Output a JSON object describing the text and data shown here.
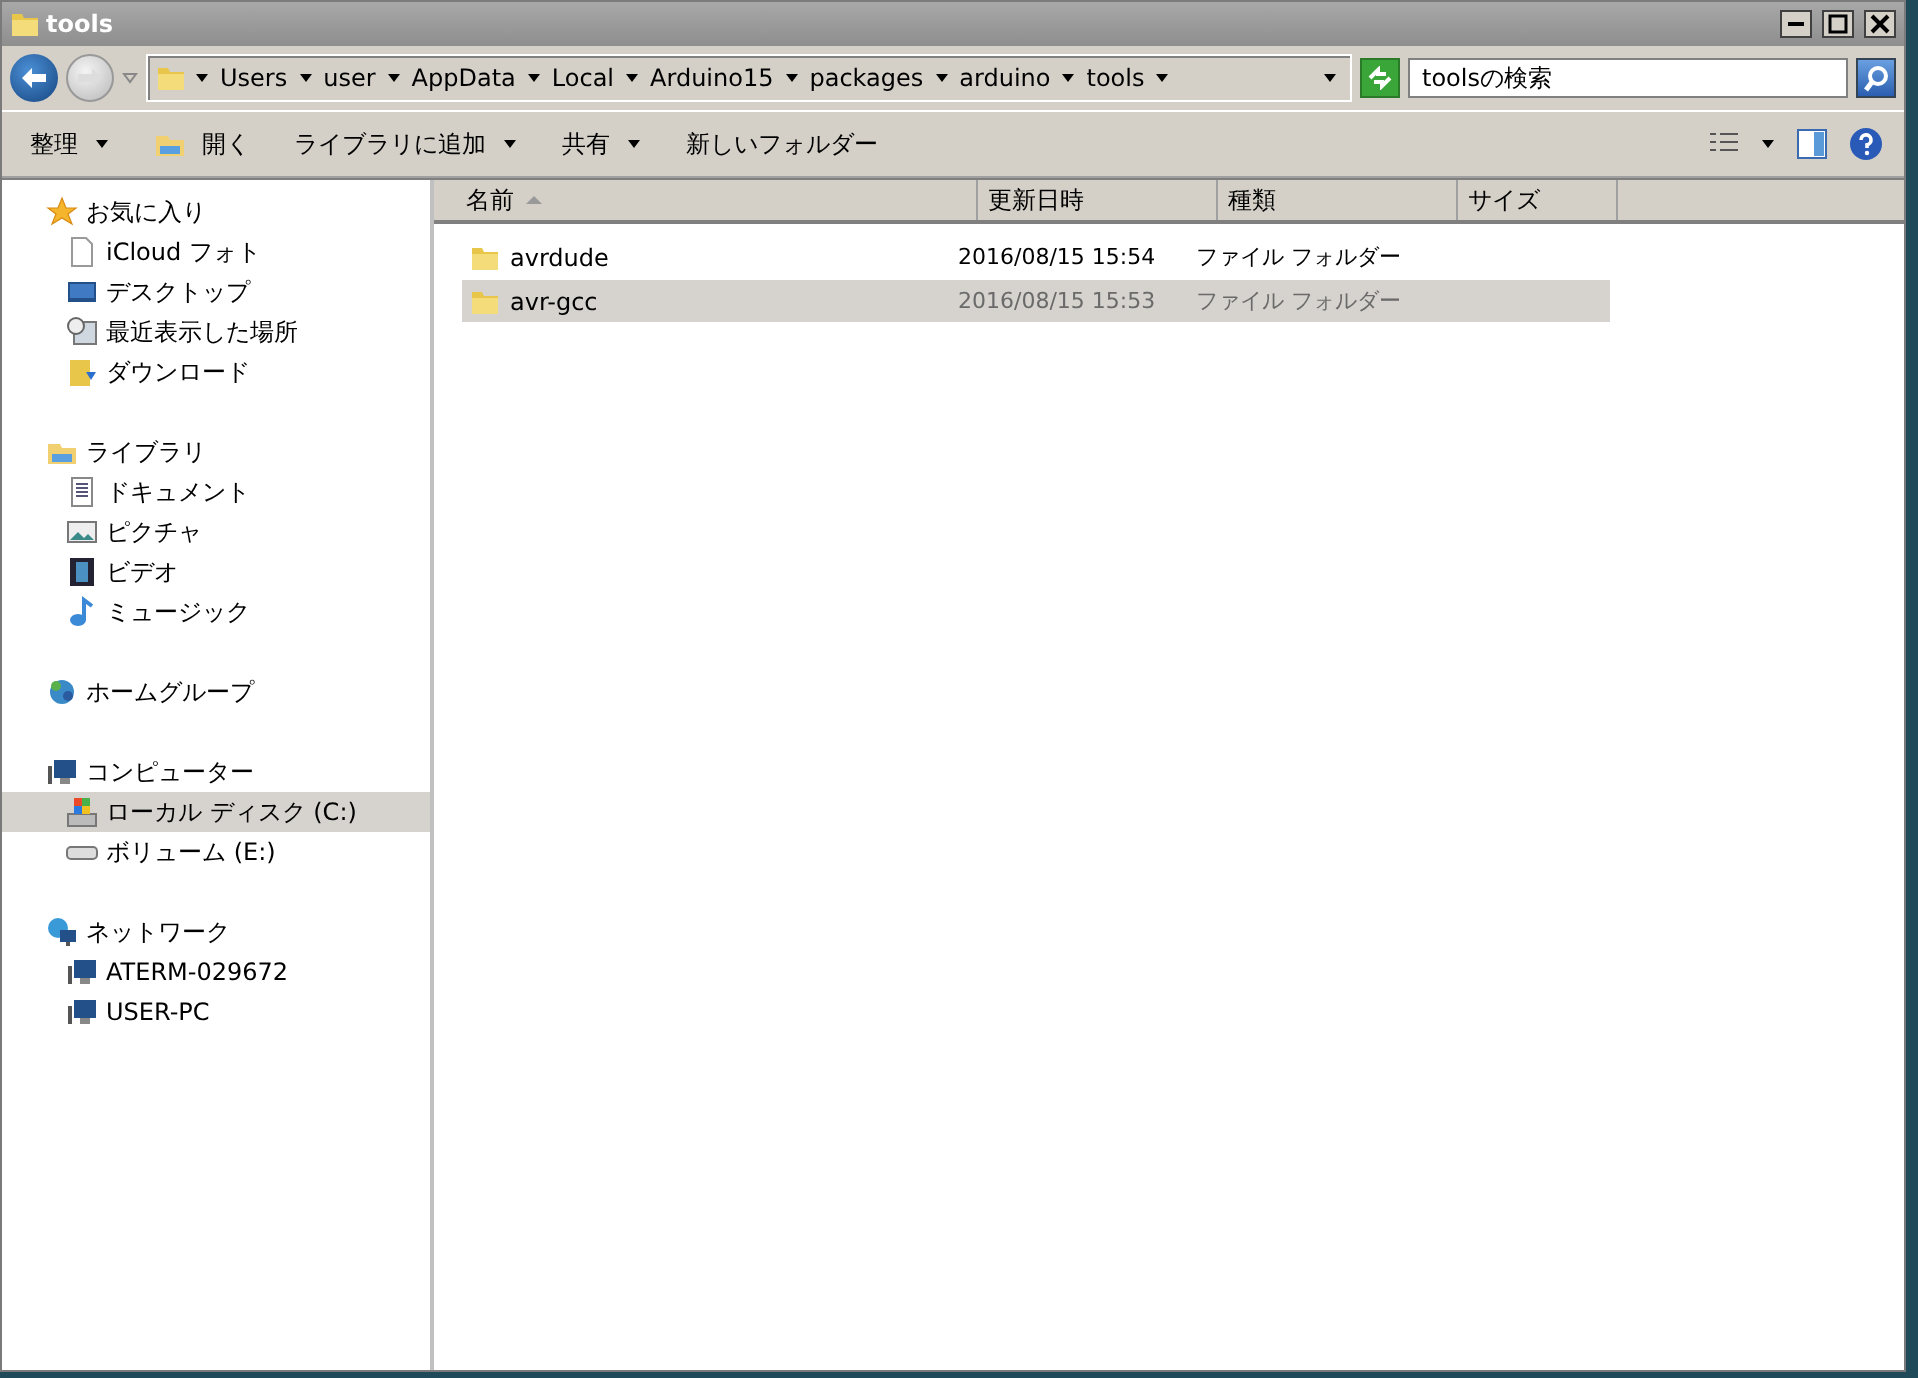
{
  "window": {
    "title": "tools"
  },
  "address_bar": {
    "path": [
      "Users",
      "user",
      "AppData",
      "Local",
      "Arduino15",
      "packages",
      "arduino",
      "tools"
    ]
  },
  "search": {
    "placeholder": "toolsの検索"
  },
  "toolbar": {
    "items": [
      {
        "label": "整理",
        "dropdown": true
      },
      {
        "label": "開く",
        "dropdown": false
      },
      {
        "label": "ライブラリに追加",
        "dropdown": true
      },
      {
        "label": "共有",
        "dropdown": true
      },
      {
        "label": "新しいフォルダー",
        "dropdown": false
      }
    ]
  },
  "sidebar": {
    "groups": [
      {
        "label": "お気に入り",
        "children": [
          {
            "label": "iCloud フォト",
            "selected": false
          },
          {
            "label": "デスクトップ",
            "selected": false
          },
          {
            "label": "最近表示した場所",
            "selected": false
          },
          {
            "label": "ダウンロード",
            "selected": false
          }
        ]
      },
      {
        "label": "ライブラリ",
        "children": [
          {
            "label": "ドキュメント",
            "selected": false
          },
          {
            "label": "ピクチャ",
            "selected": false
          },
          {
            "label": "ビデオ",
            "selected": false
          },
          {
            "label": "ミュージック",
            "selected": false
          }
        ]
      },
      {
        "label": "ホームグループ"
      },
      {
        "label": "コンピューター",
        "children": [
          {
            "label": "ローカル ディスク (C:)",
            "selected": true
          },
          {
            "label": "ボリューム (E:)",
            "selected": false
          }
        ]
      },
      {
        "label": "ネットワーク",
        "children": [
          {
            "label": "ATERM-029672",
            "selected": false
          },
          {
            "label": "USER-PC",
            "selected": false
          }
        ]
      }
    ]
  },
  "table": {
    "columns": [
      {
        "label": "名前",
        "sorted": true
      },
      {
        "label": "更新日時",
        "sorted": false
      },
      {
        "label": "種類",
        "sorted": false
      },
      {
        "label": "サイズ",
        "sorted": false
      }
    ],
    "rows": [
      {
        "name": "avrdude",
        "modified": "2016/08/15 15:54",
        "type": "ファイル フォルダー",
        "selected": false
      },
      {
        "name": "avr-gcc",
        "modified": "2016/08/15 15:53",
        "type": "ファイル フォルダー",
        "selected": true
      }
    ]
  }
}
